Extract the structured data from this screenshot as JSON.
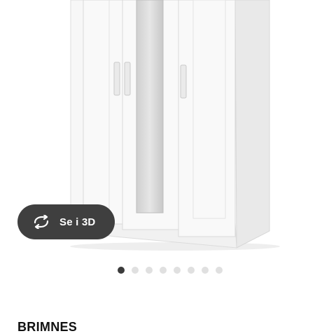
{
  "gallery": {
    "view_3d_label": "Se i 3D",
    "view_3d_icon": "rotate-arrows-icon",
    "image_count": 8,
    "active_index": 0
  },
  "product": {
    "name": "BRIMNES"
  },
  "colors": {
    "button_bg": "#3f3f3f",
    "dot_active": "#3b3b3b",
    "dot_inactive": "#e0e0e0"
  }
}
